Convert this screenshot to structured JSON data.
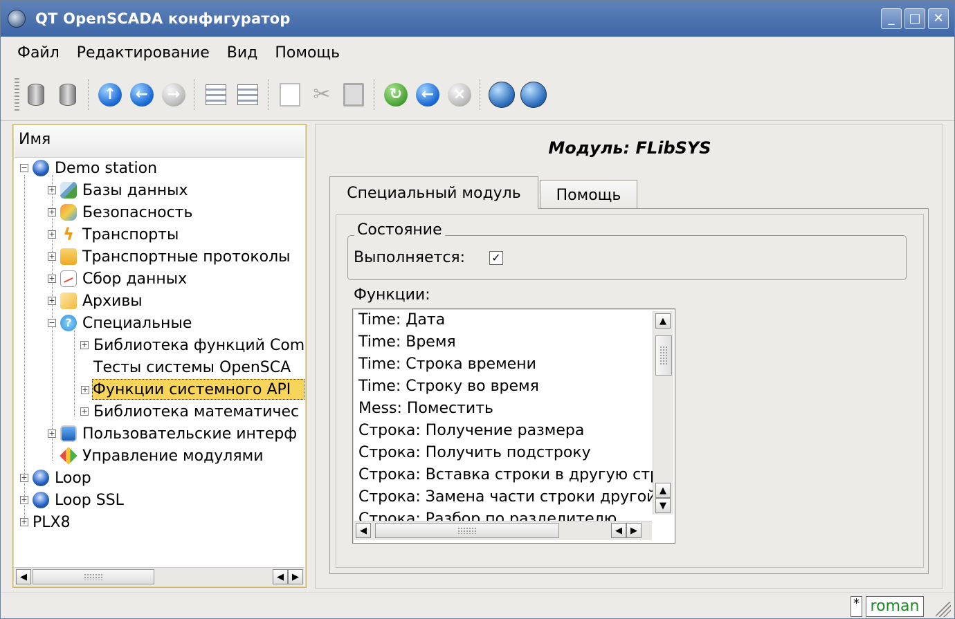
{
  "window": {
    "title": "QT OpenSCADA конфигуратор",
    "controls": {
      "minimize": "_",
      "maximize": "□",
      "close": "✕"
    }
  },
  "menu": {
    "items": [
      "Файл",
      "Редактирование",
      "Вид",
      "Помощь"
    ]
  },
  "toolbar": {
    "icons": [
      "load-db-icon",
      "save-db-icon",
      "up-icon",
      "back-icon",
      "forward-icon",
      "add-item-icon",
      "delete-item-icon",
      "copy-icon",
      "cut-icon",
      "paste-icon",
      "refresh-icon",
      "previous-icon",
      "stop-icon",
      "station-manager-icon",
      "module-config-icon"
    ]
  },
  "tree": {
    "header": "Имя",
    "nodes": [
      {
        "label": "Demo station"
      },
      {
        "label": "Базы данных"
      },
      {
        "label": "Безопасность"
      },
      {
        "label": "Транспорты"
      },
      {
        "label": "Транспортные протоколы"
      },
      {
        "label": "Сбор данных"
      },
      {
        "label": "Архивы"
      },
      {
        "label": "Специальные"
      },
      {
        "label": "Библиотека функций Com"
      },
      {
        "label": "Тесты системы OpenSCA"
      },
      {
        "label": "Функции системного API"
      },
      {
        "label": "Библиотека математичес"
      },
      {
        "label": "Пользовательские интерф"
      },
      {
        "label": "Управление модулями"
      },
      {
        "label": "Loop"
      },
      {
        "label": "Loop SSL"
      },
      {
        "label": "PLX8"
      }
    ],
    "selected": "Функции системного API"
  },
  "content": {
    "title": "Модуль: FLibSYS",
    "tabs": [
      "Специальный модуль",
      "Помощь"
    ],
    "state_group": "Состояние",
    "running_label": "Выполняется:",
    "running_checked": true,
    "functions_label": "Функции:",
    "functions": [
      "Time: Дата",
      "Time: Время",
      "Time: Строка времени",
      "Time: Строку во время",
      "Mess: Поместить",
      "Строка: Получение размера",
      "Строка: Получить подстроку",
      "Строка: Вставка строки в другую стр",
      "Строка: Замена части строки другой",
      "Строка: Разбор по разделителю"
    ]
  },
  "status": {
    "marker": "*",
    "user": "roman"
  }
}
